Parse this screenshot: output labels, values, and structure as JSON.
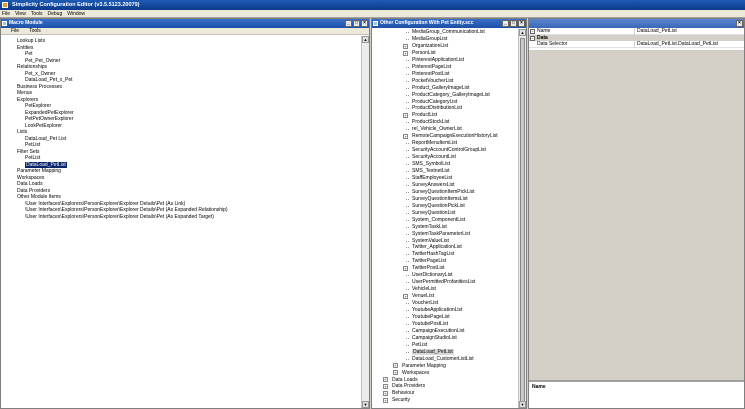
{
  "app": {
    "title": "Simplicity Configuration Editor (v3.5.5123.20079)",
    "menu": [
      "File",
      "View",
      "Tools",
      "Debug",
      "Window"
    ]
  },
  "left_pane": {
    "title": "Macro Module",
    "menu": [
      "File",
      "Tools"
    ],
    "tree": [
      {
        "label": "Lookup Lists",
        "indent": 0
      },
      {
        "label": "Entities",
        "indent": 0
      },
      {
        "label": "Pet",
        "indent": 1
      },
      {
        "label": "Pet_Pet_Owner",
        "indent": 1
      },
      {
        "label": "Relationships",
        "indent": 0
      },
      {
        "label": "Pet_x_Owner",
        "indent": 1
      },
      {
        "label": "DataLoad_Pet_x_Pet",
        "indent": 1
      },
      {
        "label": "Business Processes",
        "indent": 0
      },
      {
        "label": "Menus",
        "indent": 0
      },
      {
        "label": "Explorers",
        "indent": 0
      },
      {
        "label": "PetExplorer",
        "indent": 1
      },
      {
        "label": "ExpandedPetExplorer",
        "indent": 1
      },
      {
        "label": "PetPetOwnerExplorer",
        "indent": 1
      },
      {
        "label": "LookPetExplorer",
        "indent": 1
      },
      {
        "label": "Lists",
        "indent": 0
      },
      {
        "label": "DataLoad_Pet List",
        "indent": 1
      },
      {
        "label": "PetList",
        "indent": 1
      },
      {
        "label": "Filter Sets",
        "indent": 0
      },
      {
        "label": "PetList",
        "indent": 1
      },
      {
        "label": "DataLoad_PetList",
        "indent": 1,
        "selected": true
      },
      {
        "label": "Parameter Mapping",
        "indent": 0
      },
      {
        "label": "Workspaces",
        "indent": 0
      },
      {
        "label": "Data Loads",
        "indent": 0
      },
      {
        "label": "Data Providers",
        "indent": 0
      },
      {
        "label": "Other Module Items",
        "indent": 0
      },
      {
        "label": "\\User Interfaces\\Explorers\\PersonExplorer\\Explorer Details\\Pet (As Link)",
        "indent": 1
      },
      {
        "label": "\\User Interfaces\\Explorers\\PersonExplorer\\Explorer Details\\Pet (As Expanded Relationship)",
        "indent": 1
      },
      {
        "label": "\\User Interfaces\\Explorers\\PersonExplorer\\Explorer Details\\Pet (As Expanded Target)",
        "indent": 1
      }
    ]
  },
  "mid_pane": {
    "title": "Other Configuration With Pet Entity.scc",
    "tree": [
      {
        "label": "MediaGroup_CommunicationList",
        "indent": 1,
        "expander": false
      },
      {
        "label": "MediaGroupList",
        "indent": 1,
        "expander": false
      },
      {
        "label": "OrganizationList",
        "indent": 1,
        "expander": true
      },
      {
        "label": "PersonList",
        "indent": 1,
        "expander": true
      },
      {
        "label": "PinterestApplicationList",
        "indent": 1,
        "expander": false
      },
      {
        "label": "PinterestPageList",
        "indent": 1,
        "expander": false
      },
      {
        "label": "PinterestPostList",
        "indent": 1,
        "expander": false
      },
      {
        "label": "PocketVoucherList",
        "indent": 1,
        "expander": false
      },
      {
        "label": "Product_GalleryImageList",
        "indent": 1,
        "expander": false
      },
      {
        "label": "ProductCategory_GalleryImageList",
        "indent": 1,
        "expander": false
      },
      {
        "label": "ProductCategoryList",
        "indent": 1,
        "expander": false
      },
      {
        "label": "ProductDistributionList",
        "indent": 1,
        "expander": false
      },
      {
        "label": "ProductList",
        "indent": 1,
        "expander": true
      },
      {
        "label": "ProductStockList",
        "indent": 1,
        "expander": false
      },
      {
        "label": "rel_Vehicle_OwnerList",
        "indent": 1,
        "expander": false
      },
      {
        "label": "RemoteCampaignExecutionHistoryList",
        "indent": 1,
        "expander": true
      },
      {
        "label": "ReportMenuItemList",
        "indent": 1,
        "expander": false
      },
      {
        "label": "SecurityAccountControlGroupList",
        "indent": 1,
        "expander": false
      },
      {
        "label": "SecurityAccountList",
        "indent": 1,
        "expander": false
      },
      {
        "label": "SMS_SymbolList",
        "indent": 1,
        "expander": false
      },
      {
        "label": "SMS_TestnetList",
        "indent": 1,
        "expander": false
      },
      {
        "label": "StaffEmployeeList",
        "indent": 1,
        "expander": false
      },
      {
        "label": "SurveyAnswersList",
        "indent": 1,
        "expander": false
      },
      {
        "label": "SurveyQuestionItemPickList",
        "indent": 1,
        "expander": false
      },
      {
        "label": "SurveyQuestionItemsList",
        "indent": 1,
        "expander": false
      },
      {
        "label": "SurveyQuestionPickList",
        "indent": 1,
        "expander": false
      },
      {
        "label": "SurveyQuestionList",
        "indent": 1,
        "expander": false
      },
      {
        "label": "System_ComponentList",
        "indent": 1,
        "expander": false
      },
      {
        "label": "SystemTaskList",
        "indent": 1,
        "expander": false
      },
      {
        "label": "SystemTaskParameterList",
        "indent": 1,
        "expander": false
      },
      {
        "label": "SystemValueList",
        "indent": 1,
        "expander": false
      },
      {
        "label": "Twitter_ApplicationList",
        "indent": 1,
        "expander": false
      },
      {
        "label": "TwitterHashTagList",
        "indent": 1,
        "expander": false
      },
      {
        "label": "TwitterPageList",
        "indent": 1,
        "expander": false
      },
      {
        "label": "TwitterPostList",
        "indent": 1,
        "expander": true
      },
      {
        "label": "UserDictionaryList",
        "indent": 1,
        "expander": false
      },
      {
        "label": "UserPermittedProfanitiesList",
        "indent": 1,
        "expander": false
      },
      {
        "label": "VehicleList",
        "indent": 1,
        "expander": false
      },
      {
        "label": "VenueList",
        "indent": 1,
        "expander": true
      },
      {
        "label": "VoucherList",
        "indent": 1,
        "expander": false
      },
      {
        "label": "YoutubeApplicationList",
        "indent": 1,
        "expander": false
      },
      {
        "label": "YoutubePageList",
        "indent": 1,
        "expander": false
      },
      {
        "label": "YoutubePostList",
        "indent": 1,
        "expander": false
      },
      {
        "label": "CampaignExecutionList",
        "indent": 1,
        "expander": false
      },
      {
        "label": "CampaignStudioList",
        "indent": 1,
        "expander": false
      },
      {
        "label": "PetList",
        "indent": 1,
        "expander": false
      },
      {
        "label": "DataLoad_PetList",
        "indent": 1,
        "expander": false,
        "selected": true
      },
      {
        "label": "DataLoad_CustomerListList",
        "indent": 1,
        "expander": false
      },
      {
        "label": "Parameter Mapping",
        "indent": 0,
        "expander": true
      },
      {
        "label": "Workspaces",
        "indent": 0,
        "expander": true
      },
      {
        "label": "Data Loads",
        "indent": -1,
        "expander": true
      },
      {
        "label": "Data Providers",
        "indent": -1,
        "expander": true
      },
      {
        "label": "Behaviour",
        "indent": -1,
        "expander": true
      },
      {
        "label": "Security",
        "indent": -1,
        "expander": true
      }
    ]
  },
  "right_pane": {
    "properties": [
      {
        "key": "Name",
        "value": "DataLoad_PetList"
      }
    ],
    "category": "Data",
    "data_properties": [
      {
        "key": "Data Selector",
        "value": "DataLoad_PetList.DataLoad_PetList"
      }
    ],
    "description_label": "Name"
  }
}
